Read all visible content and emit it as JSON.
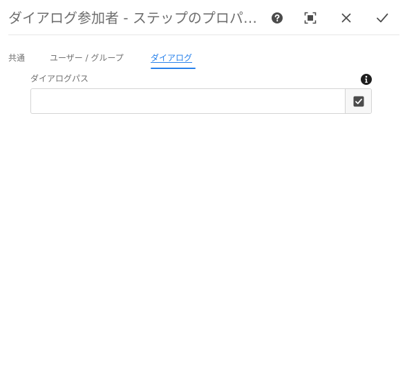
{
  "dialog": {
    "title": "ダイアログ参加者 - ステップのプロパティ",
    "actions": [
      {
        "name": "help",
        "icon": "help-icon"
      },
      {
        "name": "fullscreen",
        "icon": "fullscreen-icon"
      },
      {
        "name": "cancel",
        "icon": "close-icon"
      },
      {
        "name": "done",
        "icon": "checkmark-icon"
      }
    ]
  },
  "tabs": [
    {
      "label": "共通",
      "active": false
    },
    {
      "label": "ユーザー / グループ",
      "active": false
    },
    {
      "label": "ダイアログ",
      "active": true
    }
  ],
  "dialog_path": {
    "label": "ダイアログパス",
    "value": "",
    "info_icon": "info-icon",
    "picker_icon": "select-checkbox-icon"
  },
  "colors": {
    "accent": "#2680eb",
    "icon": "#4b4b4b",
    "border": "#d3d3d3"
  }
}
